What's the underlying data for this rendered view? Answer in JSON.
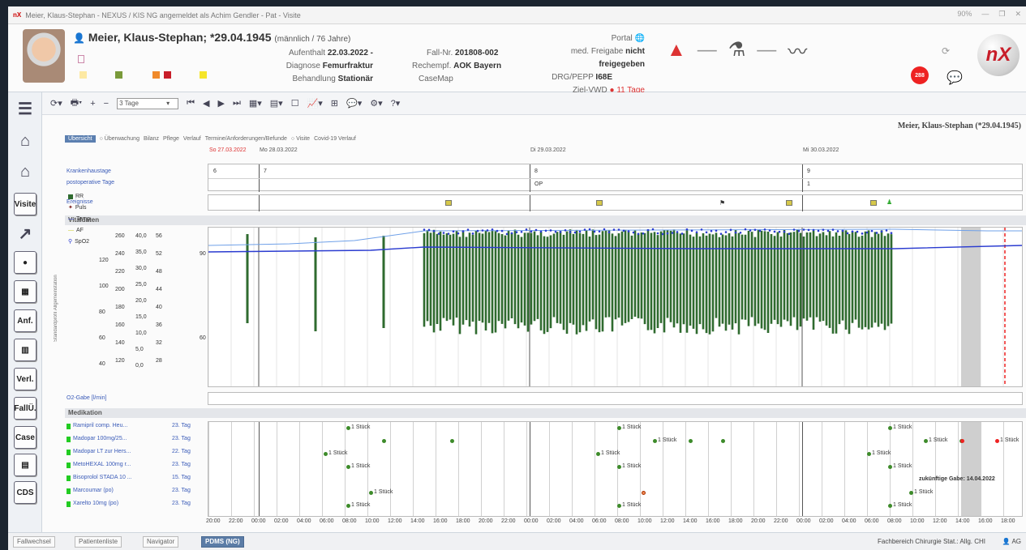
{
  "window": {
    "title": "Meier, Klaus-Stephan - NEXUS / KIS NG angemeldet als Achim Gendler - Pat - Visite",
    "zoom": "90%"
  },
  "patient": {
    "name": "Meier, Klaus-Stephan; *29.04.1945",
    "sex_age": "(männlich  / 76 Jahre)",
    "aufenthalt_label": "Aufenthalt",
    "aufenthalt": "22.03.2022 -",
    "diagnose_label": "Diagnose",
    "diagnose": "Femurfraktur",
    "behandlung_label": "Behandlung",
    "behandlung": "Stationär",
    "fall_label": "Fall-Nr.",
    "fall": "201808-002",
    "rechempf_label": "Rechempf.",
    "rechempf": "AOK Bayern",
    "casemap": "CaseMap",
    "portal": "Portal",
    "freigabe_label": "med. Freigabe",
    "freigabe": "nicht freigegeben",
    "drg_label": "DRG/PEPP",
    "drg": "I68E",
    "vwd_label": "Ziel-VWD",
    "vwd": "11 Tage",
    "notif_count": "288",
    "brand": "nX"
  },
  "toolbar": {
    "days": "3 Tage",
    "pt_name": "Meier, Klaus-Stephan (*29.04.1945)"
  },
  "tabs": [
    "Übersicht",
    "Überwachung",
    "Bilanz",
    "Pflege",
    "Verlauf",
    "Termine/Anforderungen/Befunde",
    "Visite",
    "Covid-19 Verlauf"
  ],
  "dates": {
    "d1": "So 27.03.2022",
    "d2": "Mo 28.03.2022",
    "d3": "Di 29.03.2022",
    "d4": "Mi 30.03.2022"
  },
  "rows": {
    "krankenhaustage": "Krankenhaustage",
    "postop": "postoperative Tage",
    "ereignisse": "Ereignisse",
    "kt_vals": [
      "6",
      "7",
      "8",
      "9"
    ],
    "op_vals": [
      "OP",
      "1"
    ],
    "vitaldaten": "Vitaldaten",
    "o2": "O2-Gabe [l/min]",
    "medikation": "Medikation",
    "standard": "Standardprofil Allgemeinstation"
  },
  "legend": [
    {
      "label": "RR",
      "color": "#2f6b2f"
    },
    {
      "label": "Puls",
      "color": "#7a1a1a"
    },
    {
      "label": "Temp.",
      "color": "#2a3bd0"
    },
    {
      "label": "AF",
      "color": "#c8c820"
    },
    {
      "label": "SpO2",
      "color": "#2a3bd0"
    }
  ],
  "scales": {
    "s1": [
      "260",
      "240",
      "220",
      "200",
      "180",
      "160",
      "140",
      "120"
    ],
    "s2": [
      "40,0",
      "35,0",
      "30,0",
      "25,0",
      "20,0",
      "15,0",
      "10,0",
      "5,0",
      "0,0"
    ],
    "s3": [
      "56",
      "52",
      "48",
      "44",
      "40",
      "36",
      "32",
      "28"
    ],
    "s0": [
      "120",
      "100",
      "80",
      "60",
      "40"
    ],
    "y90": "90",
    "y60": "60"
  },
  "medications": [
    {
      "name": "Ramipril comp. Heu...",
      "tag": "23. Tag"
    },
    {
      "name": "Madopar 100mg/25...",
      "tag": "23. Tag"
    },
    {
      "name": "Madopar LT zur Hers...",
      "tag": "22. Tag"
    },
    {
      "name": "MetoHEXAL 100mg r...",
      "tag": "23. Tag"
    },
    {
      "name": "Bisoprolol STADA 10 ...",
      "tag": "15. Tag"
    },
    {
      "name": "Marcoumar (po)",
      "tag": "23. Tag"
    },
    {
      "name": "Xarelto 10mg (po)",
      "tag": "23. Tag"
    }
  ],
  "dose": "1 Stück",
  "future_note": "zukünftige Gabe: 14.04.2022",
  "times": [
    "20:00",
    "22:00",
    "00:00",
    "02:00",
    "04:00",
    "06:00",
    "08:00",
    "10:00",
    "12:00",
    "14:00",
    "16:00",
    "18:00",
    "20:00",
    "22:00",
    "00:00",
    "02:00",
    "04:00",
    "06:00",
    "08:00",
    "10:00",
    "12:00",
    "14:00",
    "16:00",
    "18:00",
    "20:00",
    "22:00",
    "00:00",
    "02:00",
    "04:00",
    "06:00",
    "08:00",
    "10:00",
    "12:00",
    "14:00",
    "16:00",
    "18:00"
  ],
  "status": {
    "tabs": [
      "Fallwechsel",
      "Patientenliste",
      "Navigator",
      "PDMS (NG)"
    ],
    "right": "Fachbereich Chirurgie    Stat.: Allg. CHI",
    "user": "AG"
  },
  "sidebar": [
    "Visite",
    "Anf.",
    "Verl.",
    "FallÜ.",
    "Case",
    "CDS"
  ]
}
